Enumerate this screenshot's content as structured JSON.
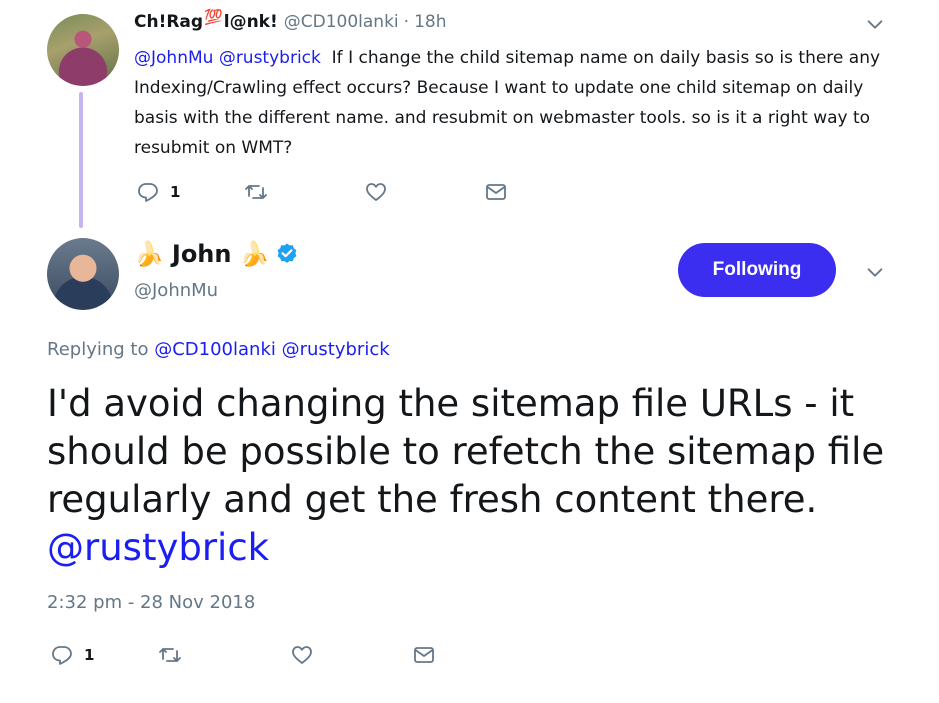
{
  "parent_tweet": {
    "name": "Ch!Rag",
    "badge": "💯",
    "name_suffix": "l@nk!",
    "handle": "@CD100lanki",
    "separator": "·",
    "time": "18h",
    "mentions": [
      "@JohnMu",
      "@rustybrick"
    ],
    "text": "If I change the child sitemap name on daily basis so is there any Indexing/Crawling effect occurs? Because I want to update one child sitemap on daily basis with the different name. and resubmit on webmaster tools. so is it a right way to resubmit on WMT?",
    "reply_count": "1"
  },
  "main_tweet": {
    "banana": "🍌",
    "name": "John",
    "handle": "@JohnMu",
    "follow_label": "Following",
    "replying_label": "Replying to",
    "replying_to": [
      "@CD100lanki",
      "@rustybrick"
    ],
    "text": "I'd avoid changing the sitemap file URLs - it should be possible to refetch the sitemap file regularly and get the fresh content there.",
    "text_mention": "@rustybrick",
    "timestamp": "2:32 pm - 28 Nov 2018",
    "reply_count": "1"
  },
  "icons": {
    "reply": "reply-icon",
    "retweet": "retweet-icon",
    "like": "heart-icon",
    "dm": "envelope-icon",
    "caret": "chevron-down-icon",
    "verified": "verified-badge-icon"
  },
  "colors": {
    "link": "#1b1ef0",
    "follow_button": "#3b2ef0",
    "thread_line": "#c4b5f0",
    "muted": "#657786",
    "verified": "#1da1f2"
  }
}
